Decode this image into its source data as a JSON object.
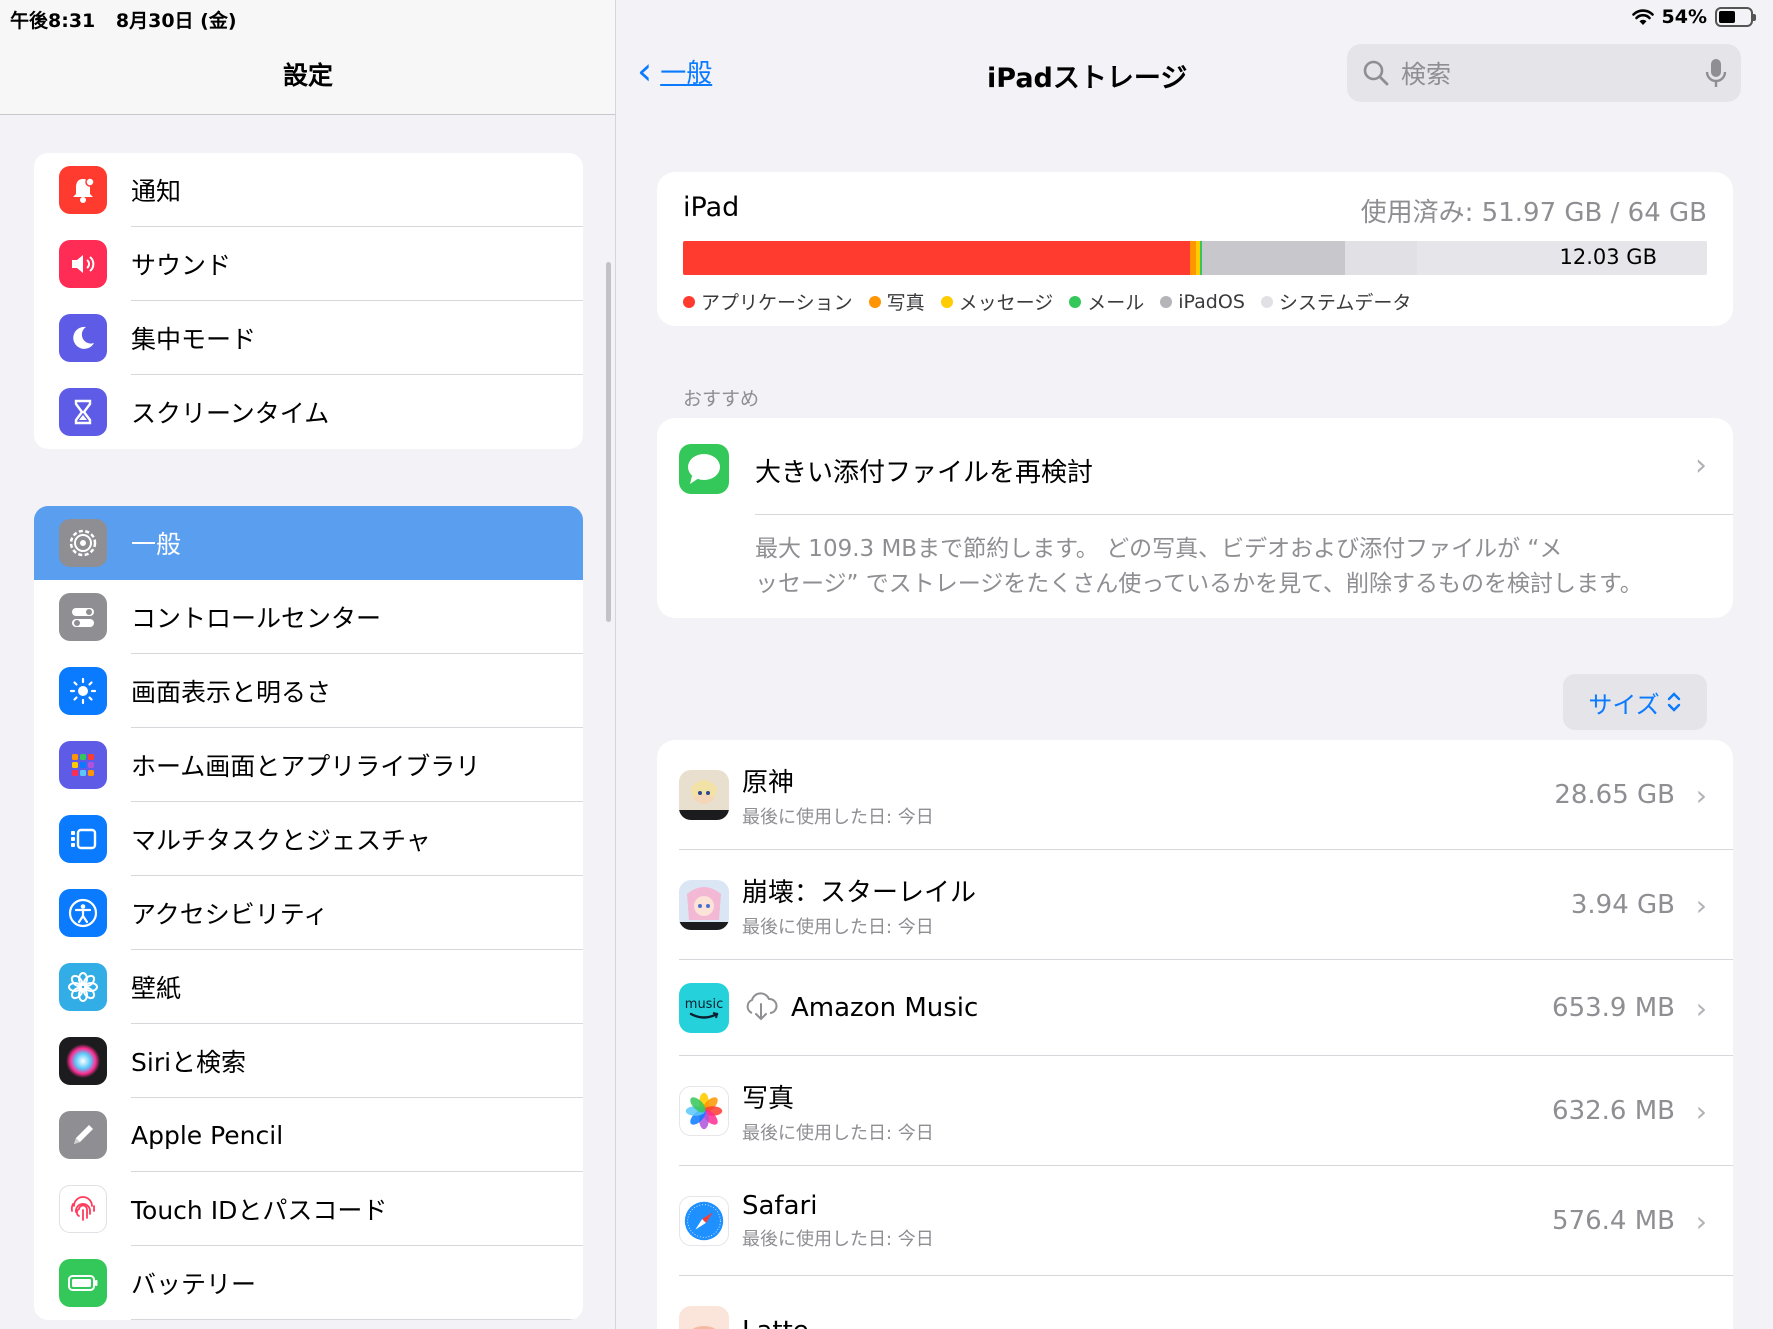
{
  "status": {
    "time": "午後8:31",
    "date": "8月30日 (金)",
    "battery": "54%",
    "battery_level": 0.54
  },
  "sidebar": {
    "title": "設定",
    "group1": [
      {
        "label": "通知",
        "icon": "bell-icon",
        "color": "#ff3b30"
      },
      {
        "label": "サウンド",
        "icon": "speaker-icon",
        "color": "#ff2d55"
      },
      {
        "label": "集中モード",
        "icon": "moon-icon",
        "color": "#5e5ce6"
      },
      {
        "label": "スクリーンタイム",
        "icon": "hourglass-icon",
        "color": "#5e5ce6"
      }
    ],
    "group2": [
      {
        "label": "一般",
        "icon": "gear-icon",
        "color": "#8e8e93",
        "selected": true
      },
      {
        "label": "コントロールセンター",
        "icon": "toggles-icon",
        "color": "#8e8e93"
      },
      {
        "label": "画面表示と明るさ",
        "icon": "sun-icon",
        "color": "#0a7aff"
      },
      {
        "label": "ホーム画面とアプリライブラリ",
        "icon": "app-grid-icon",
        "color": "#5e5ce6"
      },
      {
        "label": "マルチタスクとジェスチャ",
        "icon": "multitask-icon",
        "color": "#0a7aff"
      },
      {
        "label": "アクセシビリティ",
        "icon": "accessibility-icon",
        "color": "#0a7aff"
      },
      {
        "label": "壁紙",
        "icon": "flower-icon",
        "color": "#32ade6"
      },
      {
        "label": "Siriと検索",
        "icon": "siri-icon",
        "color": "#1c1c1e"
      },
      {
        "label": "Apple Pencil",
        "icon": "pencil-icon",
        "color": "#8e8e93"
      },
      {
        "label": "Touch IDとパスコード",
        "icon": "fingerprint-icon",
        "color": "#ffffff"
      },
      {
        "label": "バッテリー",
        "icon": "battery-icon",
        "color": "#34c759"
      }
    ]
  },
  "nav": {
    "back_label": "一般",
    "title": "iPadストレージ",
    "search_placeholder": "検索"
  },
  "storage": {
    "device": "iPad",
    "usage": "使用済み: 51.97 GB / 64 GB",
    "free_label": "12.03 GB",
    "segments": [
      {
        "name": "アプリケーション",
        "fraction": 0.495,
        "color": "#ff3b30"
      },
      {
        "name": "写真",
        "fraction": 0.006,
        "color": "#ff9500"
      },
      {
        "name": "メッセージ",
        "fraction": 0.004,
        "color": "#ffcc00"
      },
      {
        "name": "メール",
        "fraction": 0.002,
        "color": "#34c759"
      },
      {
        "name": "iPadOS",
        "fraction": 0.14,
        "color": "#c7c7cc"
      },
      {
        "name": "システムデータ",
        "fraction": 0.07,
        "color": "#e0e0e5"
      }
    ],
    "legend": [
      {
        "label": "アプリケーション",
        "color": "#ff3b30"
      },
      {
        "label": "写真",
        "color": "#ff9500"
      },
      {
        "label": "メッセージ",
        "color": "#ffcc00"
      },
      {
        "label": "メール",
        "color": "#34c759"
      },
      {
        "label": "iPadOS",
        "color": "#b4b4b9"
      },
      {
        "label": "システムデータ",
        "color": "#e0e0e5"
      }
    ]
  },
  "recommend": {
    "section": "おすすめ",
    "title": "大きい添付ファイルを再検討",
    "desc_line1": "最大 109.3 MBまで節約します。 どの写真、ビデオおよび添付ファイルが “メ",
    "desc_line2": "ッセージ” でストレージをたくさん使っているかを見て、削除するものを検討します。"
  },
  "sort": {
    "label": "サイズ"
  },
  "apps": [
    {
      "name": "原神",
      "sub": "最後に使用した日: 今日",
      "size": "28.65 GB",
      "icon": "genshin-icon"
    },
    {
      "name": "崩壊：スターレイル",
      "sub": "最後に使用した日: 今日",
      "size": "3.94 GB",
      "icon": "starrail-icon"
    },
    {
      "name": "Amazon Music",
      "sub": "",
      "size": "653.9 MB",
      "icon": "amazon-music-icon",
      "offloaded": true
    },
    {
      "name": "写真",
      "sub": "最後に使用した日: 今日",
      "size": "632.6 MB",
      "icon": "photos-icon"
    },
    {
      "name": "Safari",
      "sub": "最後に使用した日: 今日",
      "size": "576.4 MB",
      "icon": "safari-icon"
    },
    {
      "name": "Latte",
      "sub": "",
      "size": "",
      "icon": "latte-icon"
    }
  ]
}
